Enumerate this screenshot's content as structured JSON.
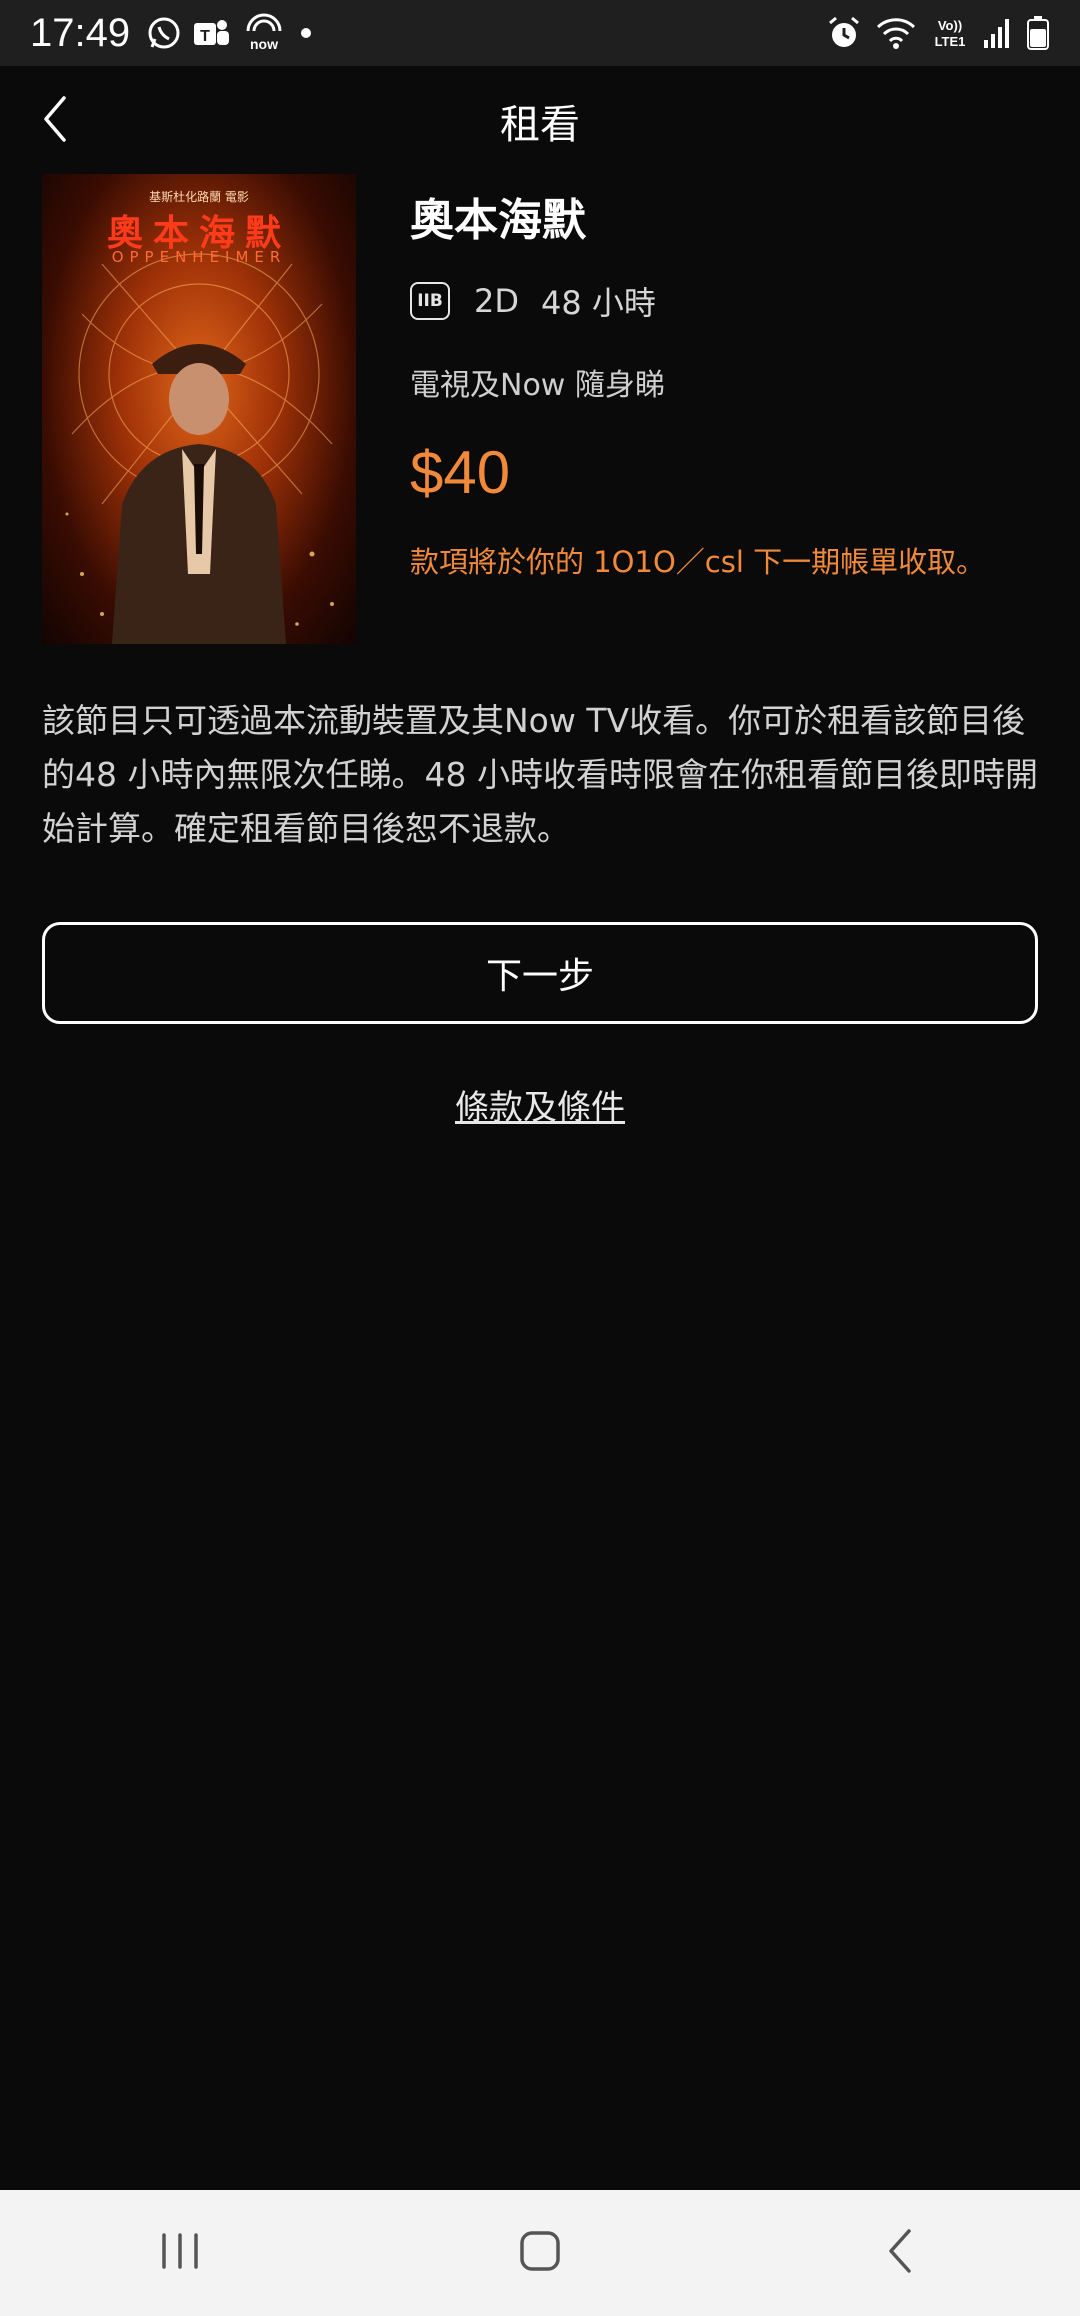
{
  "status_bar": {
    "time": "17:49",
    "left_icons": [
      "whatsapp-icon",
      "teams-icon",
      "now-icon",
      "dot-icon"
    ],
    "right_icons": [
      "alarm-icon",
      "wifi-icon",
      "volte-icon",
      "signal-icon",
      "battery-icon"
    ],
    "volte_label": "Vo)) LTE1"
  },
  "header": {
    "title": "租看",
    "back_icon": "chevron-left-icon"
  },
  "movie": {
    "poster_subtitle": "基斯杜化路蘭 電影",
    "poster_title": "奧本海默",
    "poster_title_en": "OPPENHEIMER",
    "title": "奧本海默",
    "rating": "IIB",
    "format": "2D",
    "duration": "48 小時",
    "platform": "電視及Now 隨身睇",
    "price": "$40",
    "billing_note": "款項將於你的 1O1O／csl 下一期帳單收取。"
  },
  "description": "該節目只可透過本流動裝置及其Now TV收看。你可於租看該節目後的48 小時內無限次任睇。48 小時收看時限會在你租看節目後即時開始計算。確定租看節目後恕不退款。",
  "actions": {
    "next_label": "下一步",
    "terms_label": "條款及條件"
  },
  "nav_bar": {
    "buttons": [
      "recents-icon",
      "home-icon",
      "back-icon"
    ]
  },
  "colors": {
    "background": "#0a0a0a",
    "accent": "#f08a3a",
    "status_bar": "#1f1f1f",
    "nav_bar": "#f3f3f3"
  }
}
